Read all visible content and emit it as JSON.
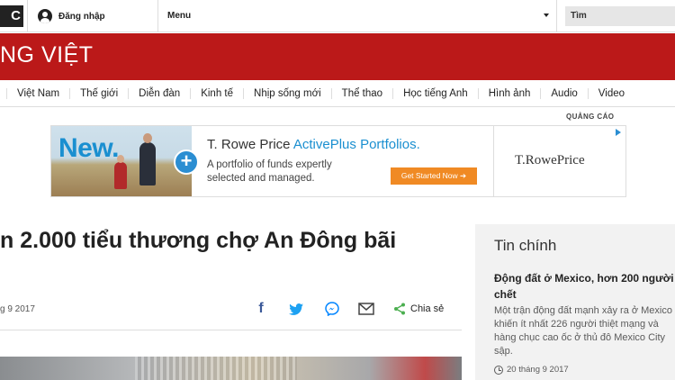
{
  "topbar": {
    "logo_fragment": "C",
    "signin_label": "Đăng nhập",
    "menu_label": "Menu",
    "search_placeholder": "Tìm"
  },
  "banner": {
    "title": "NG VIỆT"
  },
  "nav": {
    "items": [
      "Việt Nam",
      "Thế giới",
      "Diễn đàn",
      "Kinh tế",
      "Nhịp sống mới",
      "Thể thao",
      "Học tiếng Anh",
      "Hình ảnh",
      "Audio",
      "Video"
    ]
  },
  "ad": {
    "label": "QUẢNG CÁO",
    "badge": "New.",
    "headline_a": "T. Rowe Price ",
    "headline_b": "ActivePlus Portfolios.",
    "body": "A portfolio of funds expertly selected and managed.",
    "cta": "Get Started Now ➔",
    "brand": "T.RowePrice"
  },
  "article": {
    "headline": "n 2.000 tiểu thương chợ An Đông bãi",
    "date": "g 9 2017",
    "share_label": "Chia sẻ"
  },
  "sidebar": {
    "title": "Tin chính",
    "headline": "Động đất ở Mexico, hơn 200 người chết",
    "summary": "Một trận động đất mạnh xảy ra ở Mexico khiến ít nhất 226 người thiệt mạng và hàng chục cao ốc ở thủ đô Mexico City sập.",
    "date": "20 tháng 9 2017"
  },
  "colors": {
    "brand_red": "#bb1919",
    "facebook": "#3b5998",
    "twitter": "#1da1f2",
    "messenger": "#0084ff",
    "share_green": "#4caf50",
    "ad_blue": "#1a8fd0",
    "ad_orange": "#f08a24"
  }
}
